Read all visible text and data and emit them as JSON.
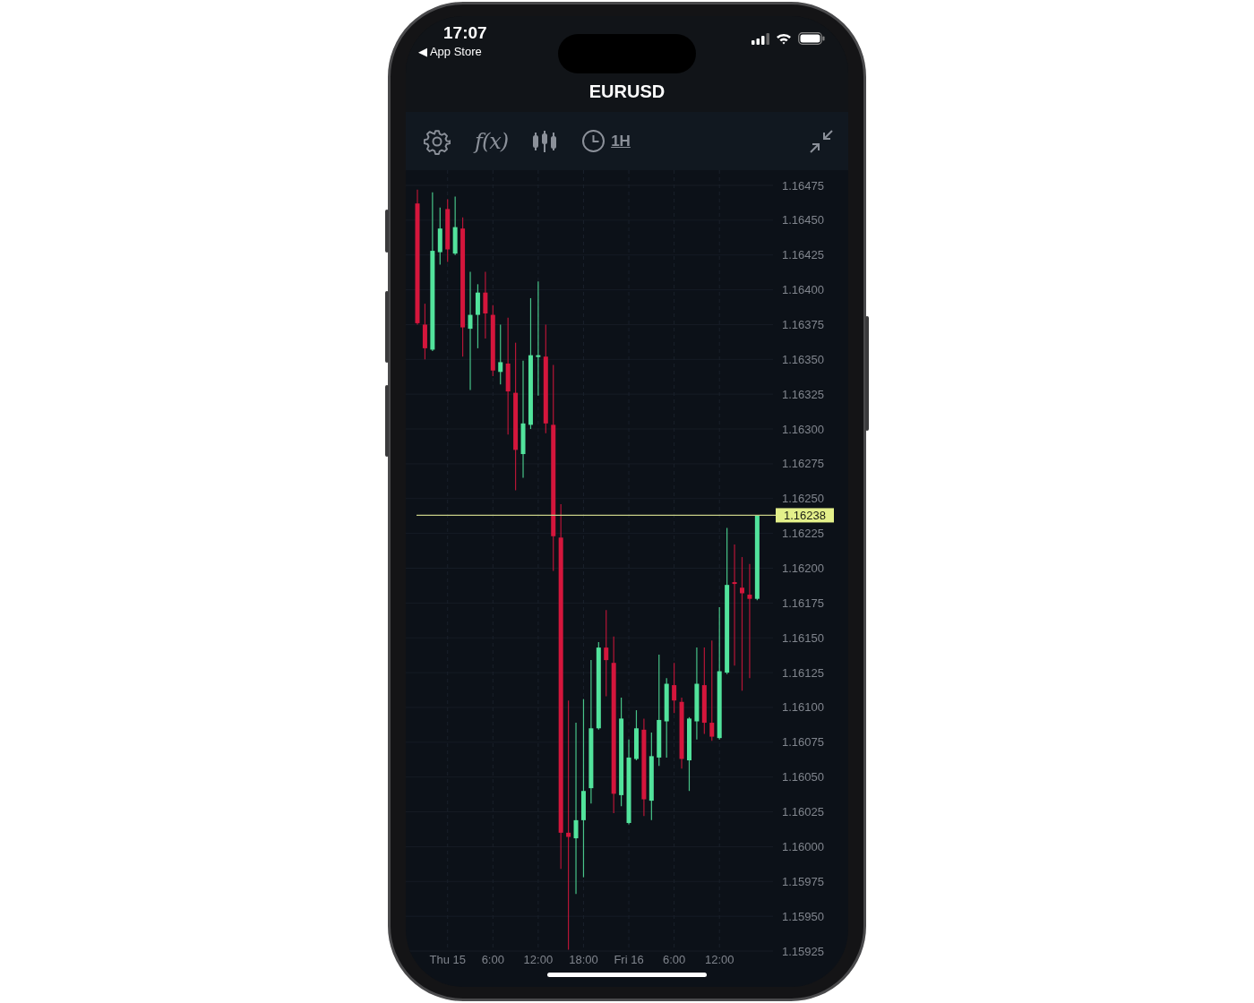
{
  "status_bar": {
    "time": "17:07",
    "back_link": "◀ App Store"
  },
  "header": {
    "title": "EURUSD"
  },
  "toolbar": {
    "items": [
      {
        "kind": "gear"
      },
      {
        "kind": "function",
        "label": "f(x)"
      },
      {
        "kind": "candles"
      },
      {
        "kind": "interval",
        "label": "1H"
      },
      {
        "kind": "collapse"
      }
    ]
  },
  "chart": {
    "chart_data": {
      "type": "candlestick",
      "categories": [
        null,
        null,
        null,
        null,
        "Thu 15",
        null,
        null,
        null,
        null,
        null,
        "6:00",
        null,
        null,
        null,
        null,
        null,
        "12:00",
        null,
        null,
        null,
        null,
        null,
        "18:00",
        null,
        null,
        null,
        null,
        null,
        "Fri 16",
        null,
        null,
        null,
        null,
        null,
        "6:00",
        null,
        null,
        null,
        null,
        null,
        "12:00",
        null,
        null,
        null,
        null,
        null
      ],
      "ohlc": [
        [
          1.16462,
          1.16472,
          1.16375,
          1.16376
        ],
        [
          1.16375,
          1.1639,
          1.1635,
          1.16358
        ],
        [
          1.16357,
          1.1647,
          1.16356,
          1.16428
        ],
        [
          1.16427,
          1.16459,
          1.16418,
          1.16444
        ],
        [
          1.16458,
          1.16465,
          1.1642,
          1.16429
        ],
        [
          1.16426,
          1.16467,
          1.16425,
          1.16445
        ],
        [
          1.16444,
          1.16452,
          1.16352,
          1.16373
        ],
        [
          1.16372,
          1.16413,
          1.16328,
          1.16382
        ],
        [
          1.16382,
          1.16404,
          1.16358,
          1.16398
        ],
        [
          1.16398,
          1.16413,
          1.16365,
          1.16383
        ],
        [
          1.16382,
          1.16389,
          1.16338,
          1.16342
        ],
        [
          1.16341,
          1.16375,
          1.16332,
          1.16348
        ],
        [
          1.16347,
          1.1638,
          1.16296,
          1.16327
        ],
        [
          1.16326,
          1.16362,
          1.16256,
          1.16285
        ],
        [
          1.16282,
          1.16349,
          1.16265,
          1.16304
        ],
        [
          1.16303,
          1.16394,
          1.163,
          1.16353
        ],
        [
          1.16352,
          1.16406,
          1.16324,
          1.16353
        ],
        [
          1.16352,
          1.16375,
          1.16297,
          1.16304
        ],
        [
          1.16303,
          1.16346,
          1.16198,
          1.16223
        ],
        [
          1.16222,
          1.16246,
          1.15984,
          1.1601
        ],
        [
          1.1601,
          1.16105,
          1.15926,
          1.16007
        ],
        [
          1.16006,
          1.16089,
          1.15966,
          1.16019
        ],
        [
          1.16019,
          1.16106,
          1.15978,
          1.1604
        ],
        [
          1.16042,
          1.16134,
          1.16031,
          1.16085
        ],
        [
          1.16085,
          1.16147,
          1.16084,
          1.16143
        ],
        [
          1.16143,
          1.1617,
          1.16108,
          1.16134
        ],
        [
          1.16132,
          1.16151,
          1.16024,
          1.16038
        ],
        [
          1.16037,
          1.16107,
          1.16029,
          1.16092
        ],
        [
          1.16017,
          1.16077,
          1.16016,
          1.16064
        ],
        [
          1.16063,
          1.16098,
          1.16062,
          1.16085
        ],
        [
          1.16084,
          1.16092,
          1.16022,
          1.16034
        ],
        [
          1.16033,
          1.16082,
          1.16019,
          1.16065
        ],
        [
          1.16064,
          1.16138,
          1.16058,
          1.16091
        ],
        [
          1.1609,
          1.16121,
          1.16064,
          1.16117
        ],
        [
          1.16116,
          1.16132,
          1.16096,
          1.16105
        ],
        [
          1.16104,
          1.16107,
          1.16056,
          1.16063
        ],
        [
          1.16062,
          1.16093,
          1.1604,
          1.16092
        ],
        [
          1.1609,
          1.16143,
          1.16077,
          1.16117
        ],
        [
          1.16116,
          1.16143,
          1.16081,
          1.16089
        ],
        [
          1.16089,
          1.16148,
          1.16076,
          1.16079
        ],
        [
          1.16078,
          1.16172,
          1.16077,
          1.16126
        ],
        [
          1.16125,
          1.16229,
          1.16124,
          1.16188
        ],
        [
          1.1619,
          1.16217,
          1.1613,
          1.16189
        ],
        [
          1.16186,
          1.16208,
          1.16112,
          1.16182
        ],
        [
          1.16181,
          1.16203,
          1.16121,
          1.16178
        ],
        [
          1.16178,
          1.16238,
          1.16177,
          1.16238
        ]
      ],
      "grid": true,
      "ylim": [
        1.15925,
        1.16475
      ],
      "ref_lines": [
        {
          "axis": "y",
          "value": 1.16238,
          "label": "1.16238"
        }
      ],
      "yticks": [
        {
          "value": 1.16475,
          "label": "1.16475"
        },
        {
          "value": 1.1645,
          "label": "1.16450"
        },
        {
          "value": 1.16425,
          "label": "1.16425"
        },
        {
          "value": 1.164,
          "label": "1.16400"
        },
        {
          "value": 1.16375,
          "label": "1.16375"
        },
        {
          "value": 1.1635,
          "label": "1.16350"
        },
        {
          "value": 1.16325,
          "label": "1.16325"
        },
        {
          "value": 1.163,
          "label": "1.16300"
        },
        {
          "value": 1.16275,
          "label": "1.16275"
        },
        {
          "value": 1.1625,
          "label": "1.16250"
        },
        {
          "value": 1.16225,
          "label": "1.16225"
        },
        {
          "value": 1.162,
          "label": "1.16200"
        },
        {
          "value": 1.16175,
          "label": "1.16175"
        },
        {
          "value": 1.1615,
          "label": "1.16150"
        },
        {
          "value": 1.16125,
          "label": "1.16125"
        },
        {
          "value": 1.161,
          "label": "1.16100"
        },
        {
          "value": 1.16075,
          "label": "1.16075"
        },
        {
          "value": 1.1605,
          "label": "1.16050"
        },
        {
          "value": 1.16025,
          "label": "1.16025"
        },
        {
          "value": 1.16,
          "label": "1.16000"
        },
        {
          "value": 1.15975,
          "label": "1.15975"
        },
        {
          "value": 1.1595,
          "label": "1.15950"
        },
        {
          "value": 1.15925,
          "label": "1.15925"
        }
      ]
    }
  }
}
